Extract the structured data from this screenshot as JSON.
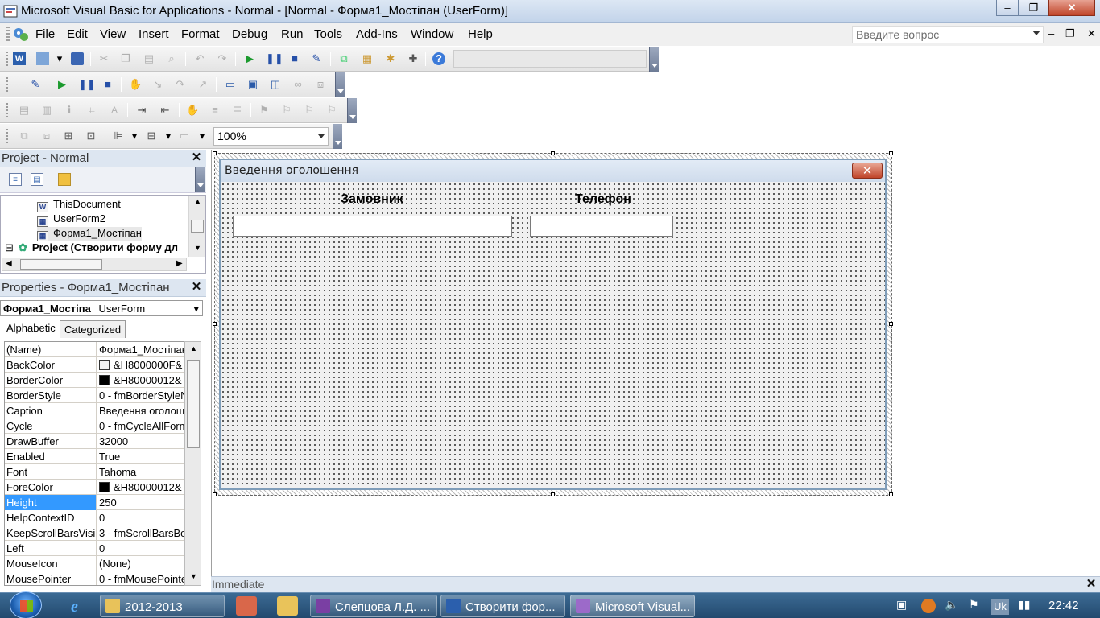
{
  "window": {
    "title": "Microsoft Visual Basic for Applications - Normal - [Normal - Форма1_Мостіпан (UserForm)]",
    "minimize": "‒",
    "restore": "❐",
    "close": "✕"
  },
  "menu": {
    "items": [
      "File",
      "Edit",
      "View",
      "Insert",
      "Format",
      "Debug",
      "Run",
      "Tools",
      "Add-Ins",
      "Window",
      "Help"
    ],
    "help_placeholder": "Введите вопрос",
    "mdi_minimize": "‒",
    "mdi_restore": "❐",
    "mdi_close": "✕"
  },
  "toolbar": {
    "zoom_value": "100%"
  },
  "project": {
    "title": "Project - Normal",
    "close": "✕",
    "tree": [
      {
        "label": "ThisDocument",
        "icon": "word-document-icon"
      },
      {
        "label": "UserForm2",
        "icon": "userform-icon"
      },
      {
        "label": "Форма1_Мостіпан",
        "icon": "userform-icon"
      },
      {
        "label": "Project (Створити форму дл",
        "icon": "vba-project-icon"
      }
    ],
    "expander": "⊟"
  },
  "properties": {
    "title": "Properties - Форма1_Мостіпан",
    "close": "✕",
    "object_name": "Форма1_Мостіпа",
    "object_type": "UserForm",
    "tabs": [
      "Alphabetic",
      "Categorized"
    ],
    "rows": [
      {
        "name": "(Name)",
        "value": "Форма1_Мостіпан"
      },
      {
        "name": "BackColor",
        "value": "&H8000000F&",
        "swatch": "#f0f0f0"
      },
      {
        "name": "BorderColor",
        "value": "&H80000012&",
        "swatch": "#000000"
      },
      {
        "name": "BorderStyle",
        "value": "0 - fmBorderStyleN"
      },
      {
        "name": "Caption",
        "value": "Введення оголош"
      },
      {
        "name": "Cycle",
        "value": "0 - fmCycleAllForm"
      },
      {
        "name": "DrawBuffer",
        "value": "32000"
      },
      {
        "name": "Enabled",
        "value": "True"
      },
      {
        "name": "Font",
        "value": "Tahoma"
      },
      {
        "name": "ForeColor",
        "value": "&H80000012&",
        "swatch": "#000000"
      },
      {
        "name": "Height",
        "value": "250",
        "selected": true
      },
      {
        "name": "HelpContextID",
        "value": "0"
      },
      {
        "name": "KeepScrollBarsVisib",
        "value": "3 - fmScrollBarsBo"
      },
      {
        "name": "Left",
        "value": "0"
      },
      {
        "name": "MouseIcon",
        "value": "(None)"
      },
      {
        "name": "MousePointer",
        "value": "0 - fmMousePointe"
      }
    ]
  },
  "userform": {
    "caption": "Введення оголошення",
    "close": "✕",
    "label_customer": "Замовник",
    "label_phone": "Телефон"
  },
  "immediate": {
    "title": "Immediate",
    "close": "✕"
  },
  "taskbar": {
    "apps": [
      {
        "label": "2012-2013",
        "icon": "folder-icon",
        "color": "#e8c25a"
      },
      {
        "label": "Слепцова Л.Д. ...",
        "icon": "onenote-icon",
        "color": "#7a3fa3"
      },
      {
        "label": "Створити фор...",
        "icon": "word-icon",
        "color": "#2b5fad"
      },
      {
        "label": "Microsoft Visual...",
        "icon": "vba-icon",
        "color": "#9c6ac9"
      }
    ],
    "language": "Uk",
    "clock": "22:42"
  }
}
